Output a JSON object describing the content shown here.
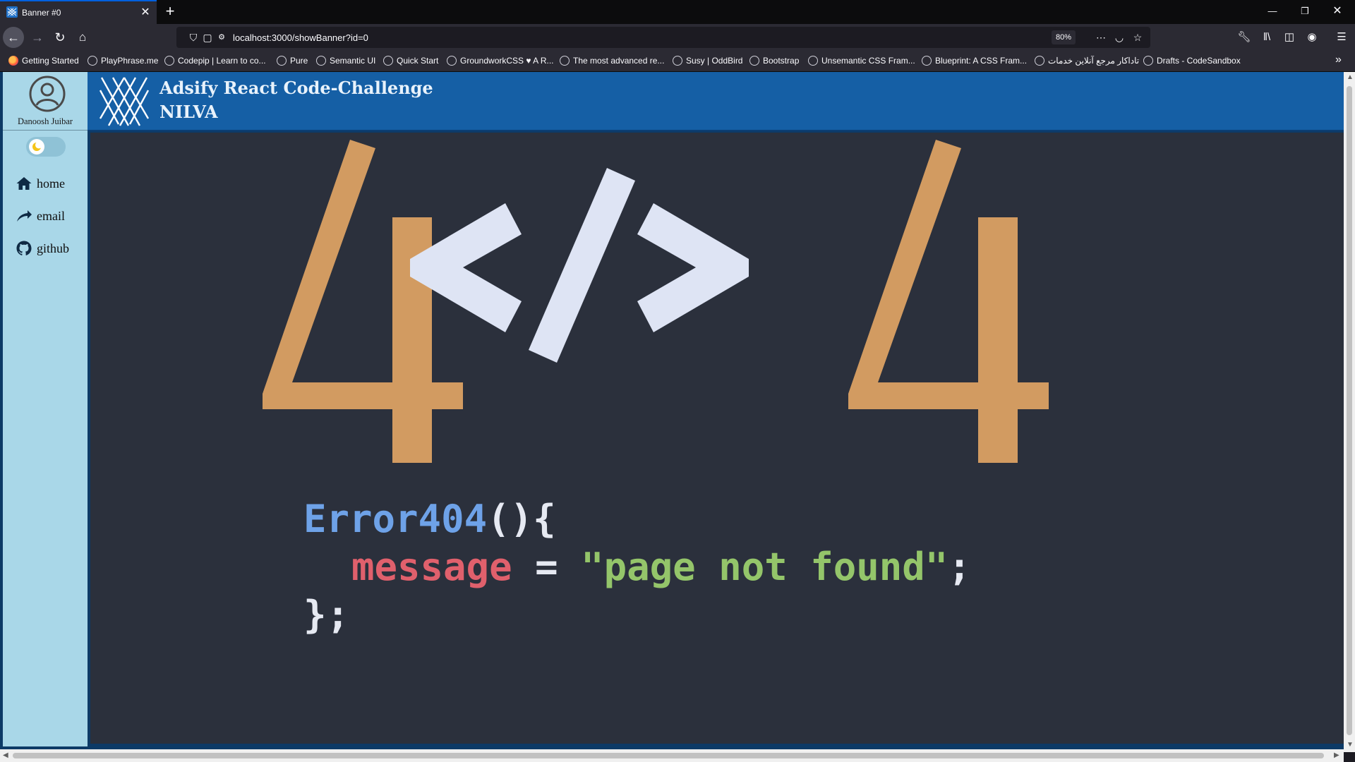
{
  "browser": {
    "tab_title": "Banner #0",
    "url": "localhost:3000/showBanner?id=0",
    "zoom": "80%",
    "bookmarks": [
      "Getting Started",
      "PlayPhrase.me",
      "Codepip | Learn to co...",
      "Pure",
      "Semantic UI",
      "Quick Start",
      "GroundworkCSS ♥ A R...",
      "The most advanced re...",
      "Susy | OddBird",
      "Bootstrap",
      "Unsemantic CSS Fram...",
      "Blueprint: A CSS Fram...",
      "تاداکار مرجع آنلاین خدمات",
      "Drafts - CodeSandbox"
    ]
  },
  "sidebar": {
    "user_name": "Danoosh Juibar",
    "nav": [
      {
        "label": "home",
        "icon": "home-icon"
      },
      {
        "label": "email",
        "icon": "email-icon"
      },
      {
        "label": "github",
        "icon": "github-icon"
      }
    ]
  },
  "header": {
    "title": "Adsify React Code-Challenge",
    "subtitle": "NILVA"
  },
  "banner": {
    "big_left": "4",
    "big_right": "4",
    "code_fn": "Error404",
    "code_paren": "(){",
    "code_var": "message",
    "code_eq": "=",
    "code_str": "\"page not found\"",
    "code_semi": ";",
    "code_close": "};"
  },
  "colors": {
    "accent_orange": "#d29b61",
    "slash_light": "#dee4f4",
    "fn_blue": "#6ea2e8",
    "var_red": "#e0606c",
    "str_green": "#94c56a",
    "header_blue": "#155fa5",
    "sidebar_bg": "#a9d7e8"
  }
}
